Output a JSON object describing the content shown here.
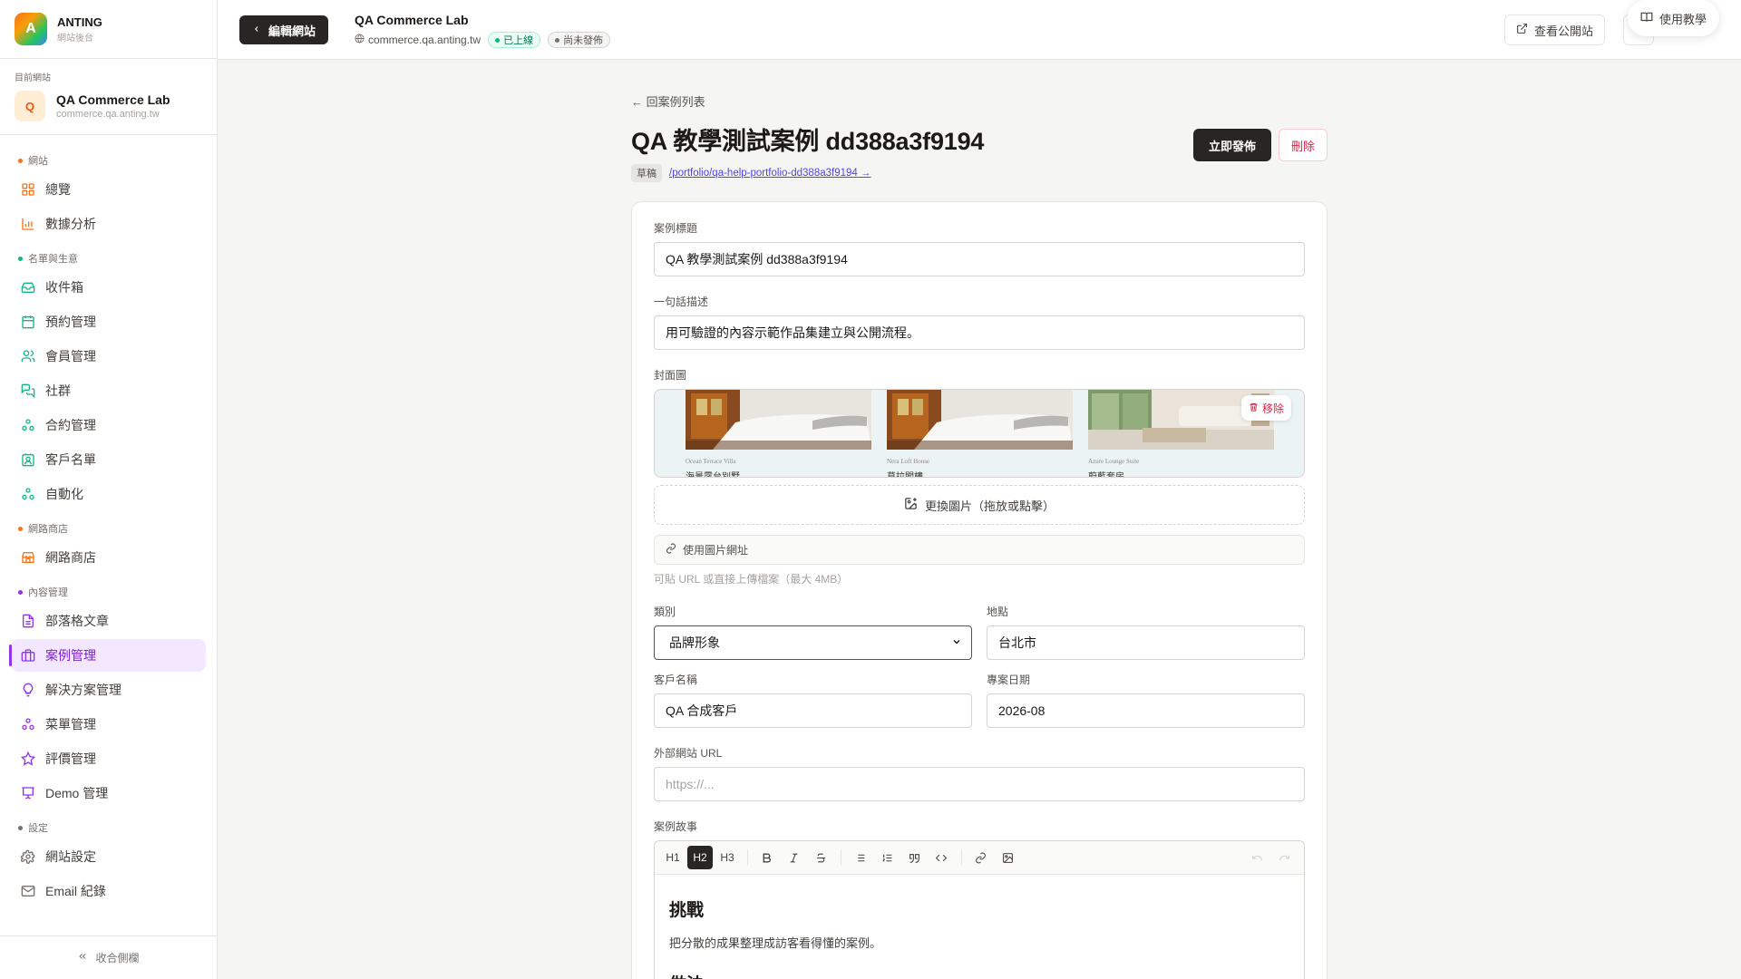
{
  "brand": {
    "logo_letter": "A",
    "name": "ANTING",
    "subtitle": "網站後台"
  },
  "current_site": {
    "label": "目前網站",
    "avatar_letter": "Q",
    "name": "QA Commerce Lab",
    "domain": "commerce.qa.anting.tw"
  },
  "sidebar": {
    "groups": [
      {
        "label": "網站",
        "color": "#f97316",
        "items": [
          {
            "label": "總覽",
            "icon": "grid-icon"
          },
          {
            "label": "數據分析",
            "icon": "bar-chart-icon"
          }
        ]
      },
      {
        "label": "名單與生意",
        "color": "#10b981",
        "items": [
          {
            "label": "收件箱",
            "icon": "inbox-icon"
          },
          {
            "label": "預約管理",
            "icon": "calendar-icon"
          },
          {
            "label": "會員管理",
            "icon": "users-icon"
          },
          {
            "label": "社群",
            "icon": "chat-icon"
          },
          {
            "label": "合約管理",
            "icon": "workflow-icon"
          },
          {
            "label": "客戶名單",
            "icon": "contact-icon"
          },
          {
            "label": "自動化",
            "icon": "workflow-icon"
          }
        ]
      },
      {
        "label": "網路商店",
        "color": "#f97316",
        "items": [
          {
            "label": "網路商店",
            "icon": "store-icon"
          }
        ]
      },
      {
        "label": "內容管理",
        "color": "#9333ea",
        "items": [
          {
            "label": "部落格文章",
            "icon": "document-icon"
          },
          {
            "label": "案例管理",
            "icon": "briefcase-icon",
            "active": true
          },
          {
            "label": "解決方案管理",
            "icon": "lightbulb-icon"
          },
          {
            "label": "菜單管理",
            "icon": "workflow-icon"
          },
          {
            "label": "評價管理",
            "icon": "star-icon"
          },
          {
            "label": "Demo 管理",
            "icon": "presentation-icon"
          }
        ]
      },
      {
        "label": "設定",
        "color": "#78716c",
        "items": [
          {
            "label": "網站設定",
            "icon": "gear-icon"
          },
          {
            "label": "Email 紀錄",
            "icon": "mail-icon"
          }
        ]
      }
    ],
    "collapse_label": "收合側欄"
  },
  "topbar": {
    "edit_site_label": "編輯網站",
    "site_name": "QA Commerce Lab",
    "site_domain": "commerce.qa.anting.tw",
    "badge_live": "已上線",
    "badge_pending": "尚未發佈",
    "view_site_label": "查看公開站",
    "tutorial_label": "使用教學"
  },
  "page": {
    "back_label": "← 回案例列表",
    "title": "QA 教學測試案例 dd388a3f9194",
    "status": "草稿",
    "slug_link": "/portfolio/qa-help-portfolio-dd388a3f9194 →",
    "publish_label": "立即發佈",
    "delete_label": "刪除"
  },
  "form": {
    "title_label": "案例標題",
    "title_value": "QA 教學測試案例 dd388a3f9194",
    "summary_label": "一句話描述",
    "summary_value": "用可驗證的內容示範作品集建立與公開流程。",
    "cover_label": "封面圖",
    "cover_thumbs": [
      {
        "caption": "Ocean Terrace Villa",
        "caption2": "海景露台別墅"
      },
      {
        "caption": "Nera Loft House",
        "caption2": "莫拉閣樓"
      },
      {
        "caption": "Azure Lounge Suite",
        "caption2": "蔚藍套房"
      }
    ],
    "remove_label": "移除",
    "replace_label": "更換圖片（拖放或點擊）",
    "use_url_label": "使用圖片網址",
    "cover_hint": "可貼 URL 或直接上傳檔案（最大 4MB）",
    "category_label": "類別",
    "category_value": "品牌形象",
    "location_label": "地點",
    "location_value": "台北市",
    "client_label": "客戶名稱",
    "client_value": "QA 合成客戶",
    "date_label": "專案日期",
    "date_value": "2026-08",
    "url_label": "外部網站 URL",
    "url_placeholder": "https://...",
    "story_label": "案例故事"
  },
  "editor": {
    "toolbar": {
      "h1": "H1",
      "h2": "H2",
      "h3": "H3"
    },
    "content": [
      {
        "heading": "挑戰",
        "body": "把分散的成果整理成訪客看得懂的案例。"
      },
      {
        "heading": "做法",
        "body": ""
      }
    ]
  }
}
